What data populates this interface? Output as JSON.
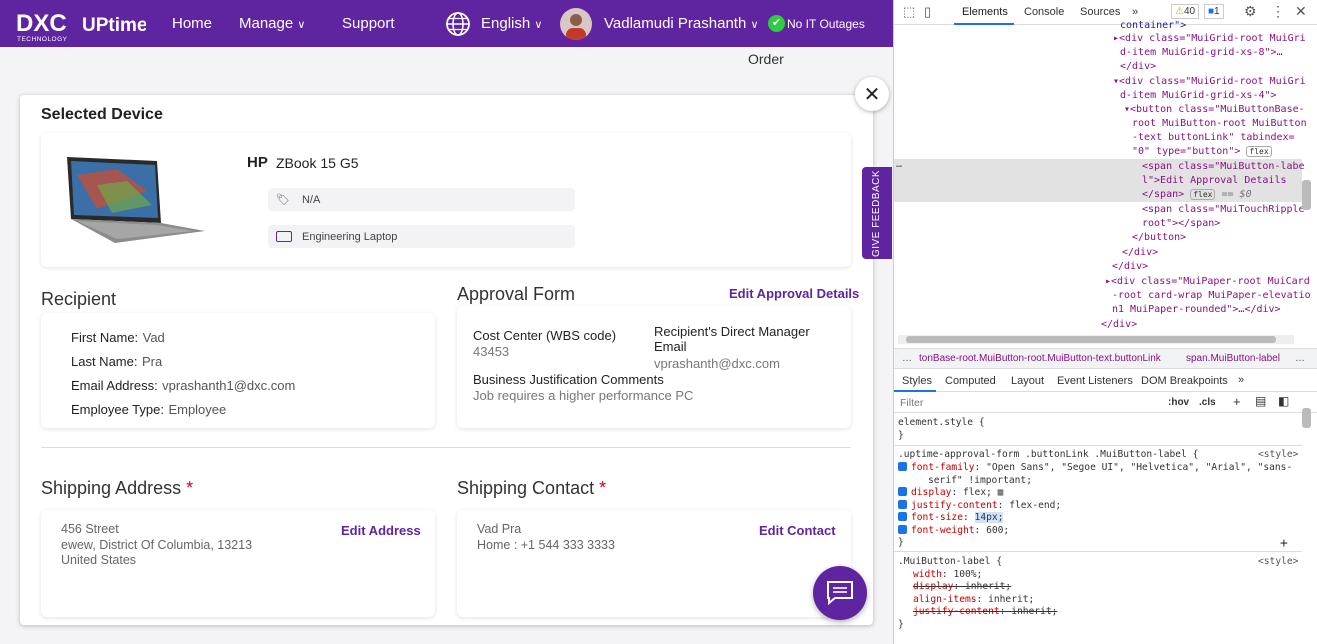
{
  "header": {
    "logo_text": "DXC",
    "logo_sub": "TECHNOLOGY",
    "brand": "UPtime",
    "nav": [
      "Home",
      "Manage",
      "Support"
    ],
    "language": "English",
    "user_name": "Vadlamudi Prashanth",
    "status": "No IT Outages",
    "order_label": "Order"
  },
  "device": {
    "section_title": "Selected Device",
    "brand": "HP",
    "model": "ZBook 15 G5",
    "tag": "N/A",
    "category": "Engineering Laptop"
  },
  "recipient": {
    "title": "Recipient",
    "rows": [
      {
        "label": "First Name:",
        "value": "Vad"
      },
      {
        "label": "Last Name:",
        "value": "Pra"
      },
      {
        "label": "Email Address:",
        "value": "vprashanth1@dxc.com"
      },
      {
        "label": "Employee Type:",
        "value": "Employee"
      }
    ]
  },
  "approval": {
    "title": "Approval Form",
    "edit_link": "Edit Approval Details",
    "cost_center_label": "Cost Center (WBS code)",
    "cost_center_value": "43453",
    "manager_label": "Recipient's Direct Manager Email",
    "manager_value": "vprashanth@dxc.com",
    "justification_label": "Business Justification Comments",
    "justification_value": "Job requires a higher performance PC"
  },
  "shipping_address": {
    "title": "Shipping Address",
    "required": "*",
    "line1": "456 Street",
    "line2": "ewew, District Of Columbia, 13213",
    "line3": "United States",
    "edit_link": "Edit Address"
  },
  "shipping_contact": {
    "title": "Shipping Contact",
    "required": "*",
    "name": "Vad Pra",
    "phone": "Home : +1 544 333 3333",
    "edit_link": "Edit Contact"
  },
  "feedback_label": "GIVE FEEDBACK",
  "devtools": {
    "tabs": [
      "Elements",
      "Console",
      "Sources"
    ],
    "warnings": "40",
    "messages": "1",
    "breadcrumb_1": "tonBase-root.MuiButton-root.MuiButton-text.buttonLink",
    "breadcrumb_2": "span.MuiButton-label",
    "style_tabs": [
      "Styles",
      "Computed",
      "Layout",
      "Event Listeners",
      "DOM Breakpoints"
    ],
    "filter_placeholder": "Filter",
    "hov": ":hov",
    "cls": ".cls",
    "element_style": "element.style {",
    "rule1_selector": ".uptime-approval-form .buttonLink .MuiButton-label {",
    "rule1_source": "<style>",
    "rule1_props": [
      {
        "name": "font-family",
        "value": "\"Open Sans\", \"Segoe UI\", \"Helvetica\", \"Arial\", \"sans-"
      },
      {
        "name": "display",
        "value": "flex;"
      },
      {
        "name": "justify-content",
        "value": "flex-end;"
      },
      {
        "name": "font-size",
        "value": "14px;"
      },
      {
        "name": "font-weight",
        "value": "600;"
      }
    ],
    "rule1_cont": "serif\" !important;",
    "rule2_selector": ".MuiButton-label {",
    "rule2_source": "<style>",
    "rule2_props": [
      {
        "name": "width",
        "value": "100%;"
      },
      {
        "name": "display",
        "value": "inherit;"
      },
      {
        "name": "align-items",
        "value": "inherit;"
      },
      {
        "name": "justify-content",
        "value": "inherit;"
      }
    ],
    "dom_lines": [
      "container\">",
      "<div class=\"MuiGrid-root MuiGri",
      "d-item MuiGrid-grid-xs-8\">…",
      "</div>",
      "<div class=\"MuiGrid-root MuiGri",
      "d-item MuiGrid-grid-xs-4\">",
      "<button class=\"MuiButtonBase-",
      "root MuiButton-root MuiButton",
      "-text buttonLink\" tabindex=",
      "\"0\" type=\"button\">",
      "<span class=\"MuiButton-labe",
      "l\">Edit Approval Details",
      "</span>",
      "<span class=\"MuiTouchRipple-",
      "root\"></span>",
      "</button>",
      "</div>",
      "</div>",
      "<div class=\"MuiPaper-root MuiCard",
      "-root card-wrap MuiPaper-elevatio",
      "n1 MuiPaper-rounded\">…</div>",
      "</div>"
    ],
    "dollar0": "== $0",
    "flex_badge": "flex"
  }
}
